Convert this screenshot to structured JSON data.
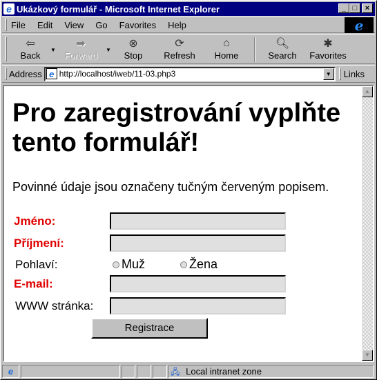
{
  "window": {
    "title": "Ukázkový formulář - Microsoft Internet Explorer"
  },
  "menu": [
    "File",
    "Edit",
    "View",
    "Go",
    "Favorites",
    "Help"
  ],
  "toolbar": {
    "back": "Back",
    "forward": "Forward",
    "stop": "Stop",
    "refresh": "Refresh",
    "home": "Home",
    "search": "Search",
    "favorites": "Favorites"
  },
  "address": {
    "label": "Address",
    "url": "http://localhost/iweb/11-03.php3",
    "links": "Links"
  },
  "page": {
    "heading": "Pro zaregistrování vyplňte tento formulář!",
    "intro": "Povinné údaje jsou označeny tučným červeným popisem.",
    "fields": {
      "jmeno": "Jméno:",
      "prijmeni": "Příjmení:",
      "pohlavi": "Pohlaví:",
      "muz": "Muž",
      "zena": "Žena",
      "email": "E-mail:",
      "www": "WWW stránka:"
    },
    "submit": "Registrace"
  },
  "status": {
    "zone": "Local intranet zone"
  }
}
